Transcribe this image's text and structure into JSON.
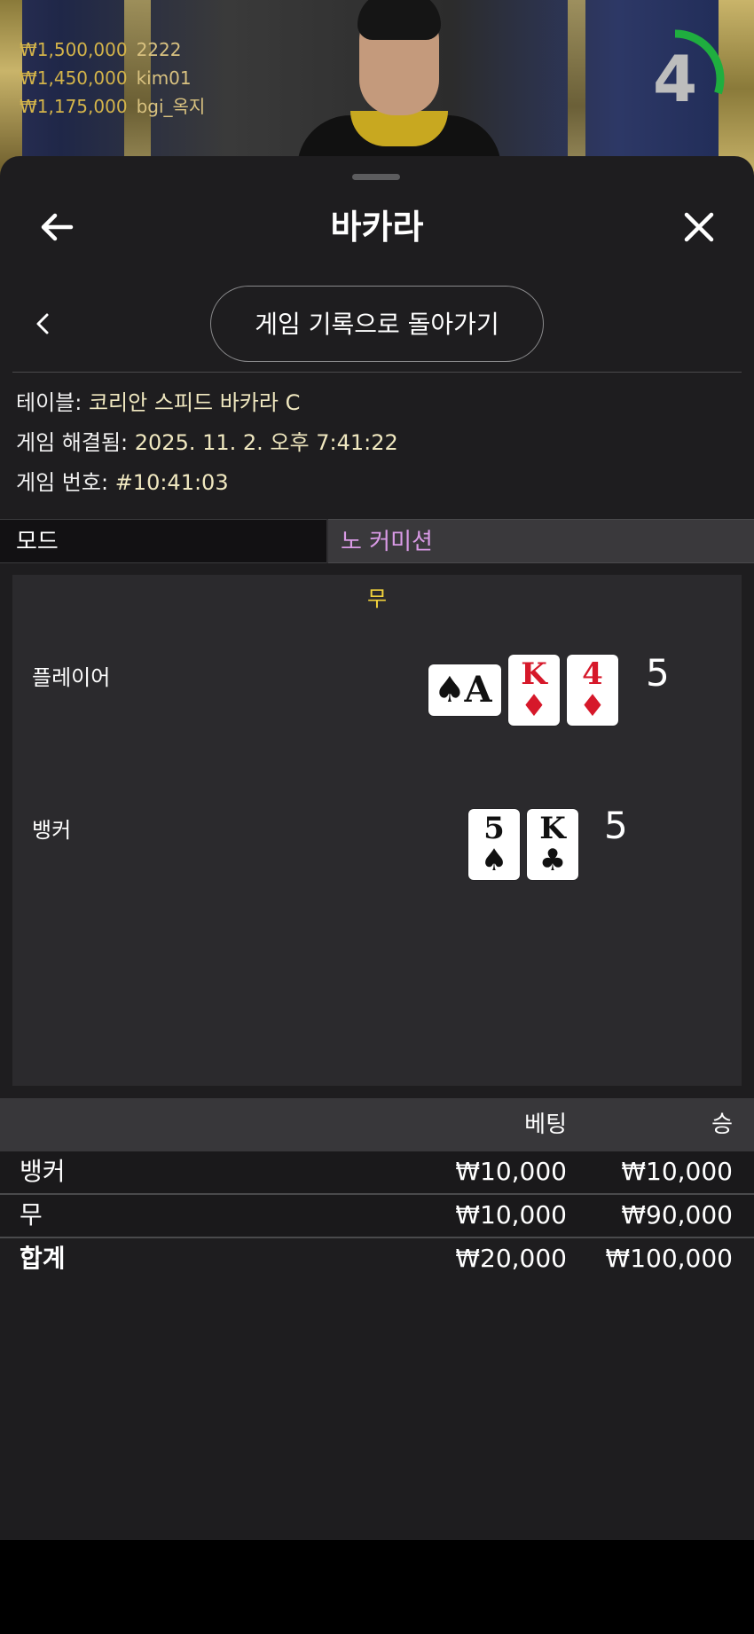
{
  "stream": {
    "winners": [
      {
        "amount": "₩1,500,000",
        "name": "2222"
      },
      {
        "amount": "₩1,450,000",
        "name": "kim01"
      },
      {
        "amount": "₩1,175,000",
        "name": "bgi_옥지"
      }
    ],
    "countdown": "4",
    "countdown_progress": 0.3,
    "countdown_color": "#1fae3f"
  },
  "header": {
    "title": "바카라",
    "back_icon": "arrow-left-icon",
    "close_icon": "close-icon"
  },
  "subnav": {
    "back_history_label": "게임 기록으로 돌아가기"
  },
  "info": {
    "table_label": "테이블:",
    "table_value": "코리안 스피드 바카라 C",
    "resolved_label": "게임 해결됨:",
    "resolved_value": "2025. 11. 2. 오후 7:41:22",
    "round_label": "게임 번호:",
    "round_value": "#10:41:03"
  },
  "mode": {
    "label": "모드",
    "value": "노 커미션"
  },
  "result": {
    "outcome": "무",
    "player": {
      "label": "플레이어",
      "score": "5",
      "cards": [
        {
          "rank": "A",
          "suit": "♠",
          "color": "black",
          "sideways": true
        },
        {
          "rank": "K",
          "suit": "♦",
          "color": "red",
          "sideways": false
        },
        {
          "rank": "4",
          "suit": "♦",
          "color": "red",
          "sideways": false
        }
      ]
    },
    "banker": {
      "label": "뱅커",
      "score": "5",
      "cards": [
        {
          "rank": "5",
          "suit": "♠",
          "color": "black",
          "sideways": false
        },
        {
          "rank": "K",
          "suit": "♣",
          "color": "black",
          "sideways": false
        }
      ]
    }
  },
  "bets_table": {
    "headers": {
      "bet": "베팅",
      "win": "승"
    },
    "rows": [
      {
        "name": "뱅커",
        "bet": "₩10,000",
        "win": "₩10,000"
      },
      {
        "name": "무",
        "bet": "₩10,000",
        "win": "₩90,000"
      }
    ],
    "total": {
      "name": "합계",
      "bet": "₩20,000",
      "win": "₩100,000"
    }
  }
}
